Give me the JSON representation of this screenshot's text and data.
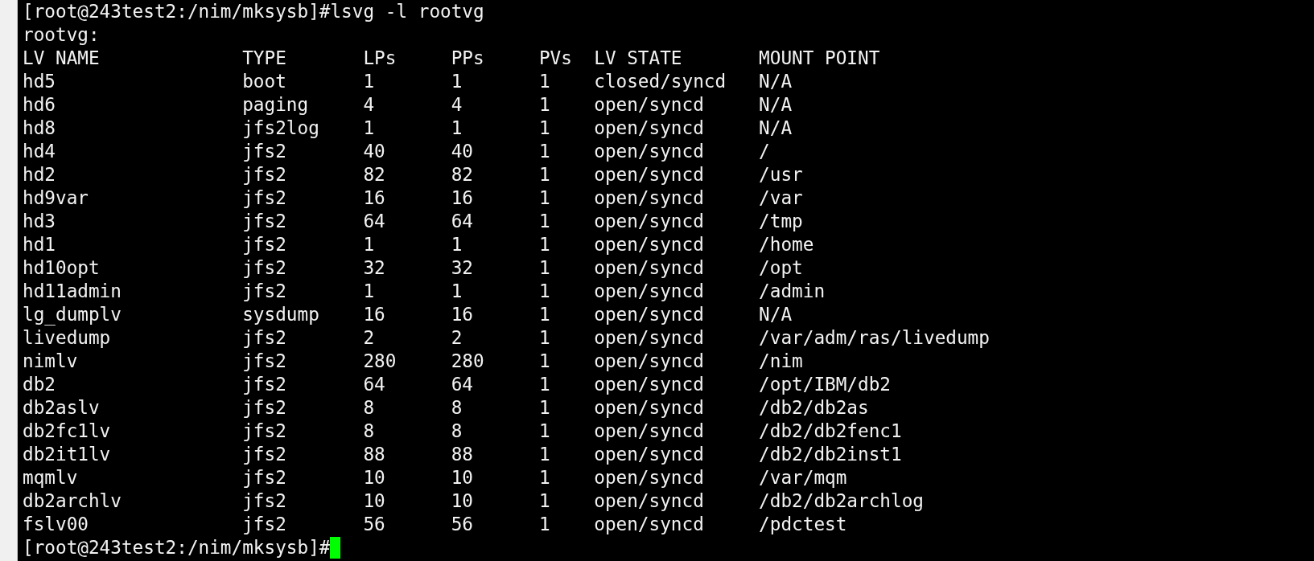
{
  "terminal": {
    "lines_before": [
      {
        "kind": "command",
        "prompt": "[root@243test2:/nim/mksysb]#",
        "command": "lsvg -l rootvg"
      },
      {
        "kind": "output",
        "text": "rootvg:"
      }
    ],
    "table": {
      "columns": [
        "LV NAME",
        "TYPE",
        "LPs",
        "PPs",
        "PVs",
        "LV STATE",
        "MOUNT POINT"
      ],
      "rows": [
        [
          "hd5",
          "boot",
          "1",
          "1",
          "1",
          "closed/syncd",
          "N/A"
        ],
        [
          "hd6",
          "paging",
          "4",
          "4",
          "1",
          "open/syncd",
          "N/A"
        ],
        [
          "hd8",
          "jfs2log",
          "1",
          "1",
          "1",
          "open/syncd",
          "N/A"
        ],
        [
          "hd4",
          "jfs2",
          "40",
          "40",
          "1",
          "open/syncd",
          "/"
        ],
        [
          "hd2",
          "jfs2",
          "82",
          "82",
          "1",
          "open/syncd",
          "/usr"
        ],
        [
          "hd9var",
          "jfs2",
          "16",
          "16",
          "1",
          "open/syncd",
          "/var"
        ],
        [
          "hd3",
          "jfs2",
          "64",
          "64",
          "1",
          "open/syncd",
          "/tmp"
        ],
        [
          "hd1",
          "jfs2",
          "1",
          "1",
          "1",
          "open/syncd",
          "/home"
        ],
        [
          "hd10opt",
          "jfs2",
          "32",
          "32",
          "1",
          "open/syncd",
          "/opt"
        ],
        [
          "hd11admin",
          "jfs2",
          "1",
          "1",
          "1",
          "open/syncd",
          "/admin"
        ],
        [
          "lg_dumplv",
          "sysdump",
          "16",
          "16",
          "1",
          "open/syncd",
          "N/A"
        ],
        [
          "livedump",
          "jfs2",
          "2",
          "2",
          "1",
          "open/syncd",
          "/var/adm/ras/livedump"
        ],
        [
          "nimlv",
          "jfs2",
          "280",
          "280",
          "1",
          "open/syncd",
          "/nim"
        ],
        [
          "db2",
          "jfs2",
          "64",
          "64",
          "1",
          "open/syncd",
          "/opt/IBM/db2"
        ],
        [
          "db2aslv",
          "jfs2",
          "8",
          "8",
          "1",
          "open/syncd",
          "/db2/db2as"
        ],
        [
          "db2fc1lv",
          "jfs2",
          "8",
          "8",
          "1",
          "open/syncd",
          "/db2/db2fenc1"
        ],
        [
          "db2it1lv",
          "jfs2",
          "88",
          "88",
          "1",
          "open/syncd",
          "/db2/db2inst1"
        ],
        [
          "mqmlv",
          "jfs2",
          "10",
          "10",
          "1",
          "open/syncd",
          "/var/mqm"
        ],
        [
          "db2archlv",
          "jfs2",
          "10",
          "10",
          "1",
          "open/syncd",
          "/db2/db2archlog"
        ],
        [
          "fslv00",
          "jfs2",
          "56",
          "56",
          "1",
          "open/syncd",
          "/pdctest"
        ]
      ]
    },
    "prompt_line": {
      "prompt": "[root@243test2:/nim/mksysb]#"
    }
  }
}
